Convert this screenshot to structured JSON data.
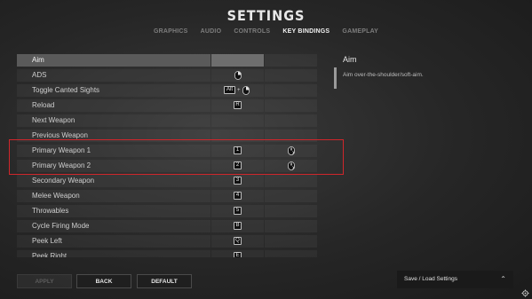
{
  "header": {
    "title": "SETTINGS",
    "tabs": [
      {
        "label": "GRAPHICS",
        "active": false
      },
      {
        "label": "AUDIO",
        "active": false
      },
      {
        "label": "CONTROLS",
        "active": false
      },
      {
        "label": "KEY BINDINGS",
        "active": true
      },
      {
        "label": "GAMEPLAY",
        "active": false
      }
    ]
  },
  "bindings": [
    {
      "action": "Aim",
      "primary": "",
      "secondary": ""
    },
    {
      "action": "ADS",
      "primary": "mouse-right-icon",
      "secondary": ""
    },
    {
      "action": "Toggle Canted Sights",
      "primary": "Alt + mouse-right-icon",
      "secondary": ""
    },
    {
      "action": "Reload",
      "primary": "R",
      "secondary": ""
    },
    {
      "action": "Next Weapon",
      "primary": "",
      "secondary": ""
    },
    {
      "action": "Previous Weapon",
      "primary": "",
      "secondary": ""
    },
    {
      "action": "Primary Weapon 1",
      "primary": "1",
      "secondary": "mouse-wheel-up-icon"
    },
    {
      "action": "Primary Weapon 2",
      "primary": "2",
      "secondary": "mouse-wheel-down-icon"
    },
    {
      "action": "Secondary Weapon",
      "primary": "3",
      "secondary": ""
    },
    {
      "action": "Melee Weapon",
      "primary": "4",
      "secondary": ""
    },
    {
      "action": "Throwables",
      "primary": "5",
      "secondary": ""
    },
    {
      "action": "Cycle Firing Mode",
      "primary": "B",
      "secondary": ""
    },
    {
      "action": "Peek Left",
      "primary": "Q",
      "secondary": ""
    },
    {
      "action": "Peek Right",
      "primary": "E",
      "secondary": ""
    }
  ],
  "keys": {
    "alt": "Alt",
    "reload": "R",
    "pw1": "1",
    "pw2": "2",
    "sec": "3",
    "melee": "4",
    "throw": "5",
    "firemode": "B",
    "peekleft": "Q",
    "peekright": "E"
  },
  "description": {
    "title": "Aim",
    "text": "Aim over-the-shoulder/soft-aim."
  },
  "buttons": {
    "apply": "APPLY",
    "back": "BACK",
    "default": "DEFAULT",
    "save_load": "Save / Load Settings"
  },
  "colors": {
    "highlight_border": "#d0262b",
    "selected_row": "#6e6e6e"
  }
}
